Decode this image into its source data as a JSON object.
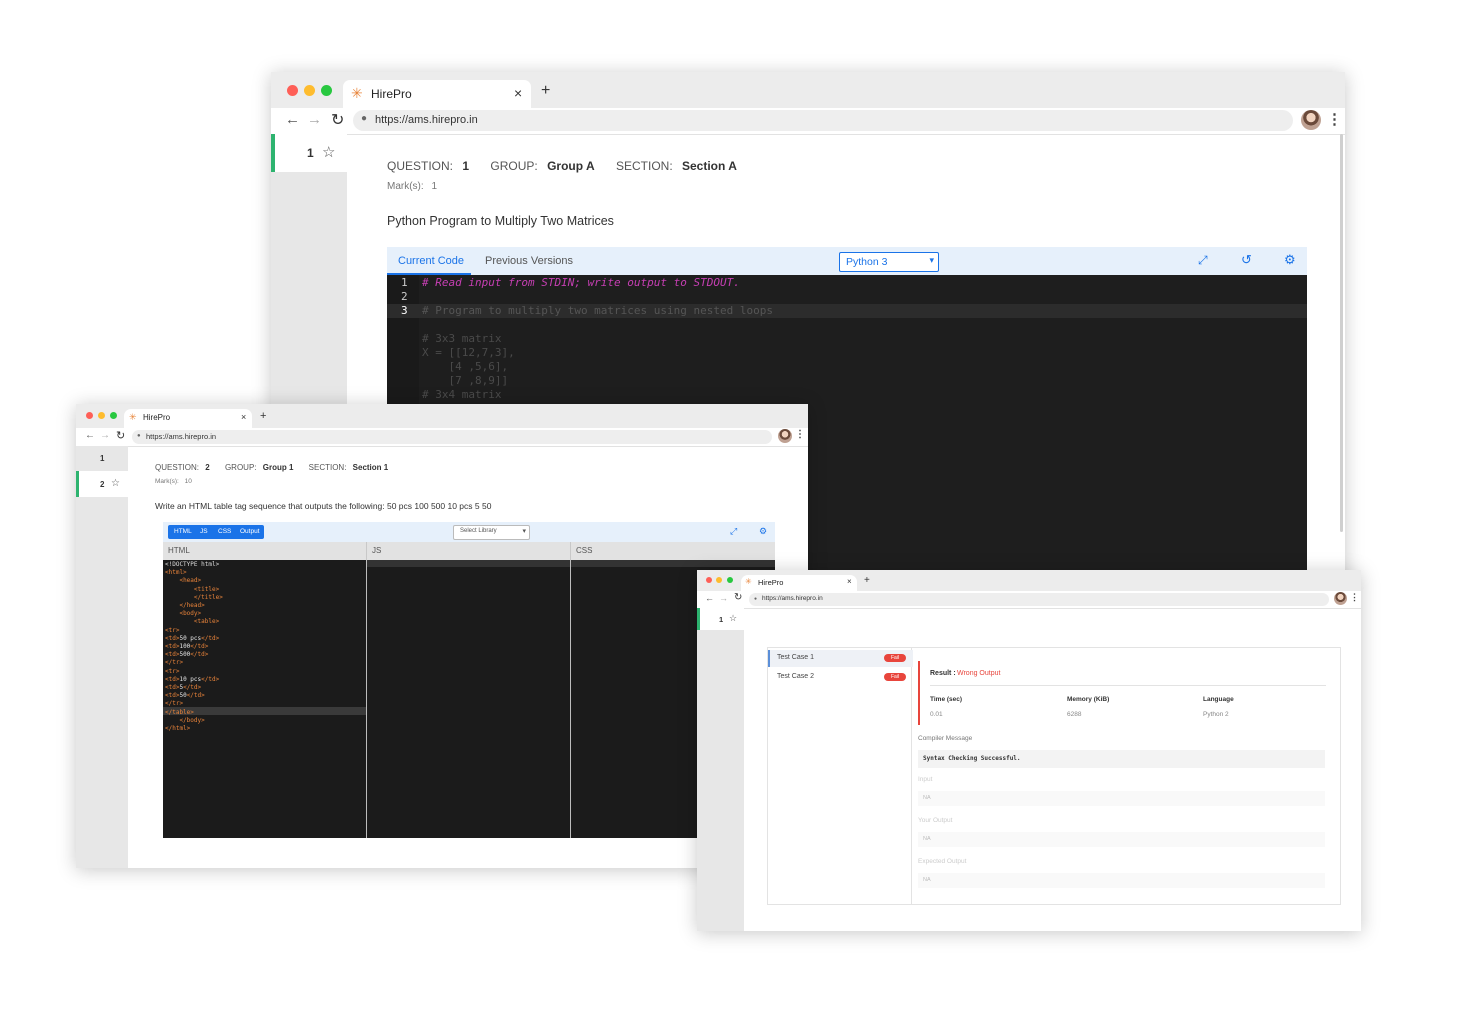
{
  "browser": {
    "tab_title": "HirePro",
    "url": "https://ams.hirepro.in",
    "close": "×",
    "new_tab": "+"
  },
  "win1": {
    "sidebar": [
      {
        "number": "1"
      }
    ],
    "question_label": "QUESTION:",
    "question_value": "1",
    "group_label": "GROUP:",
    "group_value": "Group A",
    "section_label": "SECTION:",
    "section_value": "Section A",
    "marks_label": "Mark(s):",
    "marks_value": "1",
    "title": "Python Program to Multiply Two Matrices",
    "tabs": [
      "Current Code",
      "Previous Versions"
    ],
    "language": "Python 3",
    "line_numbers": [
      "1",
      "2",
      "3"
    ],
    "code_lines": [
      "# Read input from STDIN; write output to STDOUT.",
      "",
      "# Program to multiply two matrices using nested loops",
      "",
      "# 3x3 matrix",
      "X = [[12,7,3],",
      "    [4 ,5,6],",
      "    [7 ,8,9]]",
      "# 3x4 matrix"
    ]
  },
  "win2": {
    "sidebar": [
      {
        "number": "1"
      },
      {
        "number": "2"
      }
    ],
    "question_label": "QUESTION:",
    "question_value": "2",
    "group_label": "GROUP:",
    "group_value": "Group 1",
    "section_label": "SECTION:",
    "section_value": "Section 1",
    "marks_label": "Mark(s):",
    "marks_value": "10",
    "title": "Write an HTML table tag sequence that outputs the following: 50 pcs 100 500 10 pcs 5 50",
    "mode_tabs": [
      "HTML",
      "JS",
      "CSS",
      "Output"
    ],
    "library_placeholder": "Select Library",
    "panes": [
      "HTML",
      "JS",
      "CSS"
    ],
    "html_code": [
      "<!DOCTYPE html>",
      "<html>",
      "    <head>",
      "        <title>",
      "        </title>",
      "    </head>",
      "    <body>",
      "        <table>",
      "<tr>",
      "<td>50 pcs</td>",
      "<td>100</td>",
      "<td>500</td>",
      "</tr>",
      "<tr>",
      "<td>10 pcs</td>",
      "<td>5</td>",
      "<td>50</td>",
      "</tr>",
      "</table>",
      "    </body>",
      "</html>"
    ]
  },
  "win3": {
    "sidebar": [
      {
        "number": "1"
      }
    ],
    "test_cases": [
      {
        "name": "Test Case 1",
        "status": "Fail"
      },
      {
        "name": "Test Case 2",
        "status": "Fail"
      }
    ],
    "result_label": "Result :",
    "result_value": "Wrong Output",
    "time_label": "Time (sec)",
    "time_value": "0.01",
    "memory_label": "Memory (KiB)",
    "memory_value": "6288",
    "language_label": "Language",
    "language_value": "Python 2",
    "compiler_label": "Compiler Message",
    "compiler_value": "Syntax Checking Successful.",
    "input_label": "Input",
    "input_value": "NA",
    "your_output_label": "Your Output",
    "your_output_value": "NA",
    "expected_output_label": "Expected Output",
    "expected_output_value": "NA"
  },
  "colors": {
    "accent_blue": "#1a73e8",
    "green": "#2db36f",
    "fail_red": "#e8453c",
    "editor_bg": "#1e1e1e"
  }
}
